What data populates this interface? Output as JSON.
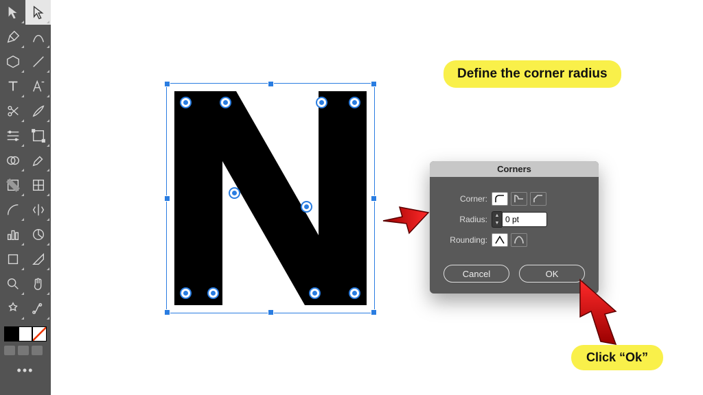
{
  "tools": {
    "items": [
      "selection-tool",
      "direct-selection-tool",
      "pen-tool",
      "curvature-tool",
      "polygon-tool",
      "line-tool",
      "type-tool",
      "touch-type-tool",
      "scissors-tool",
      "knife-tool",
      "width-tool",
      "free-transform-tool",
      "shape-builder-tool",
      "eyedropper-tool",
      "gradient-tool",
      "mesh-tool",
      "arc-tool",
      "reflect-tool",
      "column-graph-tool",
      "pie-graph-tool",
      "artboard-tool",
      "slice-tool",
      "zoom-tool",
      "hand-tool",
      "symbol-sprayer-tool",
      "blend-tool"
    ],
    "selectedIndex": 1
  },
  "dialog": {
    "title": "Corners",
    "cornerLabel": "Corner:",
    "radiusLabel": "Radius:",
    "radiusValue": "0 pt",
    "roundingLabel": "Rounding:",
    "cancel": "Cancel",
    "ok": "OK",
    "cornerTypeSelected": 0,
    "roundingSelected": 0
  },
  "callouts": {
    "defineRadius": "Define the corner radius",
    "clickOk": "Click “Ok”"
  }
}
